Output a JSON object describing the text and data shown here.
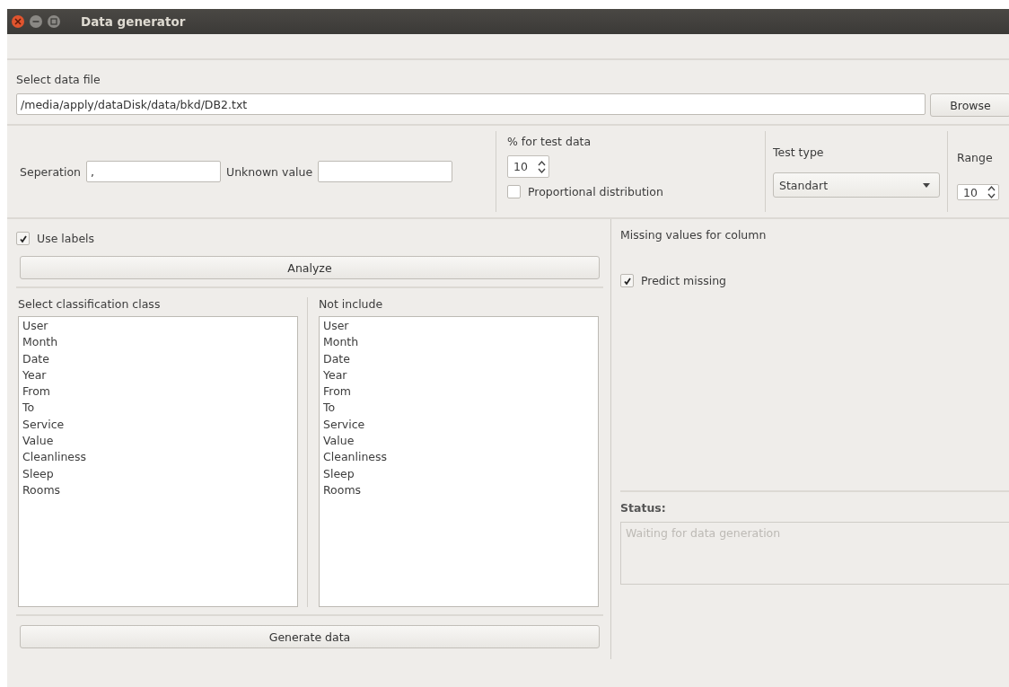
{
  "window": {
    "title": "Data generator"
  },
  "file": {
    "label": "Select data file",
    "value": "/media/apply/dataDisk/data/bkd/DB2.txt",
    "button": "Browse"
  },
  "separation": {
    "label": "Seperation",
    "value": ","
  },
  "unknown_value": {
    "label": "Unknown value"
  },
  "test_data": {
    "label": "% for test data",
    "value": "10",
    "proportional": {
      "label": "Proportional distribution",
      "checked": false
    }
  },
  "test_type": {
    "label": "Test type",
    "value": "Standart"
  },
  "range": {
    "label": "Range",
    "value": "10"
  },
  "use_labels": {
    "label": "Use labels",
    "checked": true
  },
  "analyze_button": "Analyze",
  "classification": {
    "label": "Select classification class",
    "items": [
      "User",
      "Month",
      "Date",
      "Year",
      "From",
      "To",
      "Service",
      "Value",
      "Cleanliness",
      "Sleep",
      "Rooms"
    ]
  },
  "not_include": {
    "label": "Not include",
    "items": [
      "User",
      "Month",
      "Date",
      "Year",
      "From",
      "To",
      "Service",
      "Value",
      "Cleanliness",
      "Sleep",
      "Rooms"
    ]
  },
  "generate_button": "Generate data",
  "missing": {
    "label": "Missing values for column",
    "predict": {
      "label": "Predict missing",
      "checked": true
    }
  },
  "status": {
    "label": "Status:",
    "placeholder": "Waiting for data generation"
  }
}
